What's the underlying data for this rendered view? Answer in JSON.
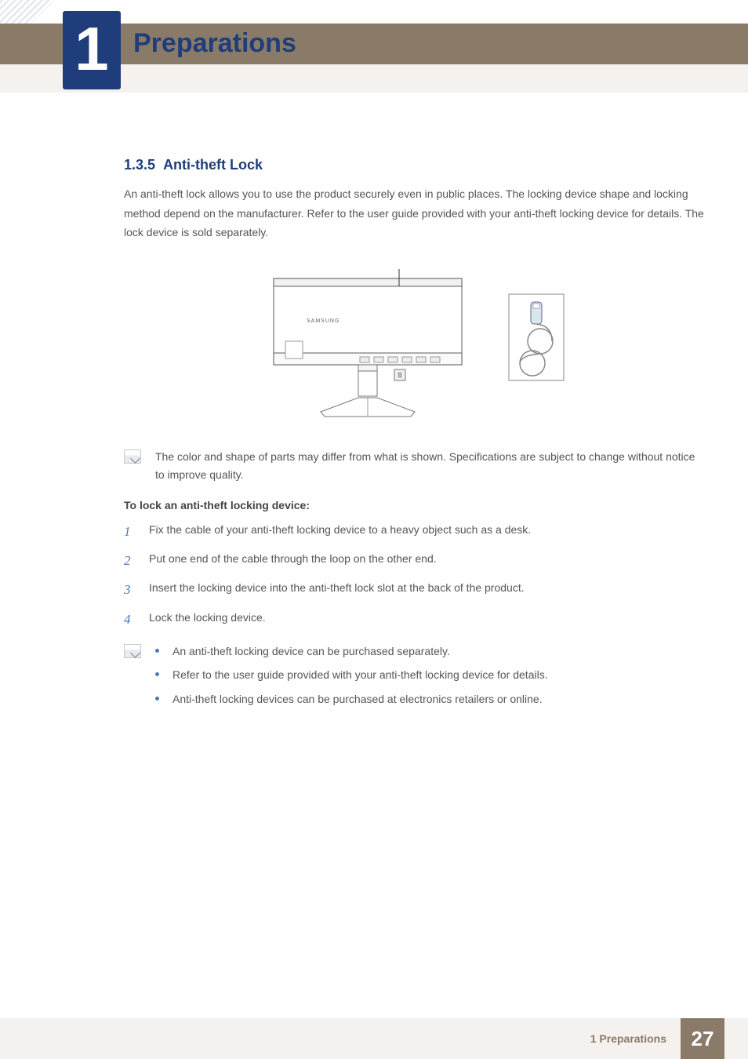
{
  "header": {
    "chapter_number": "1",
    "chapter_title": "Preparations"
  },
  "section": {
    "number": "1.3.5",
    "title": "Anti-theft Lock",
    "intro": "An anti-theft lock allows you to use the product securely even in public places. The locking device shape and locking method depend on the manufacturer. Refer to the user guide provided with your anti-theft locking device for details. The lock device is sold separately.",
    "diagram_brand": "SAMSUNG",
    "note1": "The color and shape of parts may differ from what is shown. Specifications are subject to change without notice to improve quality.",
    "procedure_heading": "To lock an anti-theft locking device:",
    "steps": [
      "Fix the cable of your anti-theft locking device to a heavy object such as a desk.",
      "Put one end of the cable through the loop on the other end.",
      "Insert the locking device into the anti-theft lock slot at the back of the product.",
      "Lock the locking device."
    ],
    "note2_items": [
      "An anti-theft locking device can be purchased separately.",
      "Refer to the user guide provided with your anti-theft locking device for details.",
      "Anti-theft locking devices can be purchased at electronics retailers or online."
    ]
  },
  "footer": {
    "label": "1 Preparations",
    "page": "27"
  }
}
